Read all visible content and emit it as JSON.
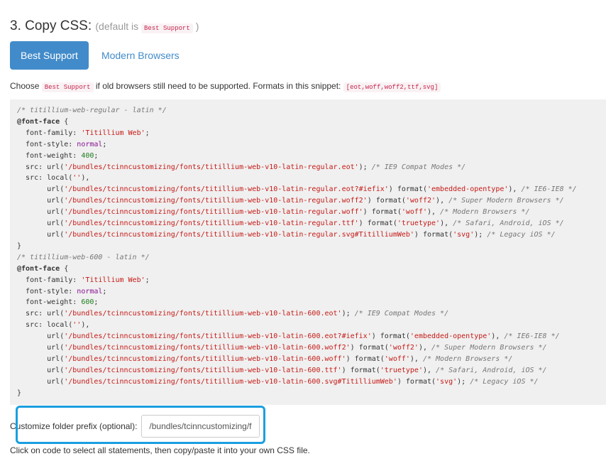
{
  "step": {
    "title": "3. Copy CSS:",
    "default_prefix": "(default is",
    "default_value": "Best Support",
    "default_suffix": ")"
  },
  "tabs": [
    {
      "label": "Best Support",
      "active": true
    },
    {
      "label": "Modern Browsers",
      "active": false
    }
  ],
  "choose": {
    "prefix": "Choose",
    "code": "Best Support",
    "middle": "if old browsers still need to be supported. Formats in this snippet:",
    "formats": "[eot,woff,woff2,ttf,svg]"
  },
  "code_block": {
    "lines": [
      "/* titillium-web-regular - latin */",
      "@font-face {",
      "  font-family: 'Titillium Web';",
      "  font-style: normal;",
      "  font-weight: 400;",
      "  src: url('/bundles/tcinncustomizing/fonts/titillium-web-v10-latin-regular.eot'); /* IE9 Compat Modes */",
      "  src: local(''),",
      "       url('/bundles/tcinncustomizing/fonts/titillium-web-v10-latin-regular.eot?#iefix') format('embedded-opentype'), /* IE6-IE8 */",
      "       url('/bundles/tcinncustomizing/fonts/titillium-web-v10-latin-regular.woff2') format('woff2'), /* Super Modern Browsers */",
      "       url('/bundles/tcinncustomizing/fonts/titillium-web-v10-latin-regular.woff') format('woff'), /* Modern Browsers */",
      "       url('/bundles/tcinncustomizing/fonts/titillium-web-v10-latin-regular.ttf') format('truetype'), /* Safari, Android, iOS */",
      "       url('/bundles/tcinncustomizing/fonts/titillium-web-v10-latin-regular.svg#TitilliumWeb') format('svg'); /* Legacy iOS */",
      "}",
      "/* titillium-web-600 - latin */",
      "@font-face {",
      "  font-family: 'Titillium Web';",
      "  font-style: normal;",
      "  font-weight: 600;",
      "  src: url('/bundles/tcinncustomizing/fonts/titillium-web-v10-latin-600.eot'); /* IE9 Compat Modes */",
      "  src: local(''),",
      "       url('/bundles/tcinncustomizing/fonts/titillium-web-v10-latin-600.eot?#iefix') format('embedded-opentype'), /* IE6-IE8 */",
      "       url('/bundles/tcinncustomizing/fonts/titillium-web-v10-latin-600.woff2') format('woff2'), /* Super Modern Browsers */",
      "       url('/bundles/tcinncustomizing/fonts/titillium-web-v10-latin-600.woff') format('woff'), /* Modern Browsers */",
      "       url('/bundles/tcinncustomizing/fonts/titillium-web-v10-latin-600.ttf') format('truetype'), /* Safari, Android, iOS */",
      "       url('/bundles/tcinncustomizing/fonts/titillium-web-v10-latin-600.svg#TitilliumWeb') format('svg'); /* Legacy iOS */",
      "}"
    ]
  },
  "prefix": {
    "label": "Customize folder prefix (optional):",
    "value": "/bundles/tcinncustomizing/fonts/"
  },
  "footer": {
    "note": "Click on code to select all statements, then copy/paste it into your own CSS file."
  },
  "colors": {
    "accent": "#428bca",
    "highlight": "#1a9fe0",
    "code_bg": "#f0f0f0"
  }
}
